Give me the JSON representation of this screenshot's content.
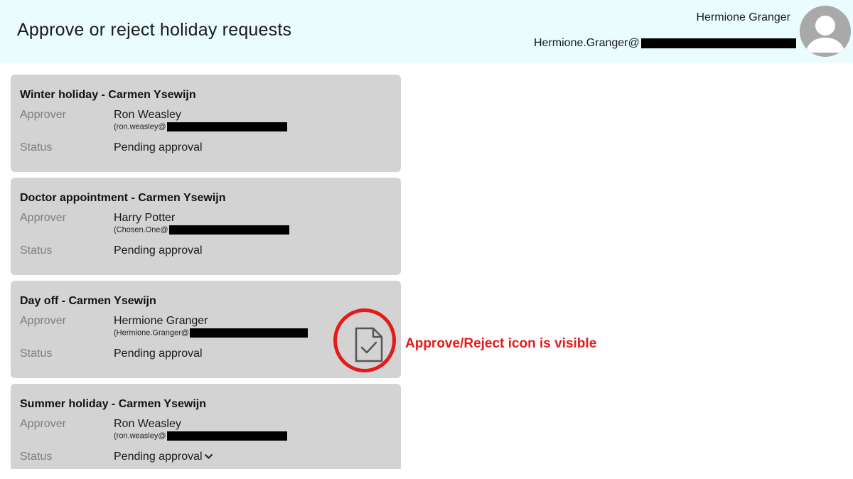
{
  "header": {
    "title": "Approve or reject holiday requests",
    "user_name": "Hermione Granger",
    "user_email": "Hermione.Granger@"
  },
  "labels": {
    "approver": "Approver",
    "status": "Status"
  },
  "requests": [
    {
      "title": "Winter holiday - Carmen Ysewijn",
      "approver": "Ron Weasley",
      "approver_email": "(ron.weasley@",
      "status": "Pending approval"
    },
    {
      "title": "Doctor appointment - Carmen Ysewijn",
      "approver": "Harry Potter",
      "approver_email": "(Chosen.One@",
      "status": "Pending approval"
    },
    {
      "title": "Day off - Carmen Ysewijn",
      "approver": "Hermione Granger",
      "approver_email": "(Hermione.Granger@",
      "status": "Pending approval",
      "approve_reject_icon_visible": true
    },
    {
      "title": "Summer holiday - Carmen Ysewijn",
      "approver": "Ron Weasley",
      "approver_email": "(ron.weasley@",
      "status": "Pending approval"
    }
  ],
  "annotation": {
    "text": "Approve/Reject icon is visible"
  },
  "colors": {
    "header_bg": "#eafcfd",
    "card_bg": "#d3d3d3",
    "annotation": "#e21b1b",
    "label": "#7d7d7d"
  }
}
